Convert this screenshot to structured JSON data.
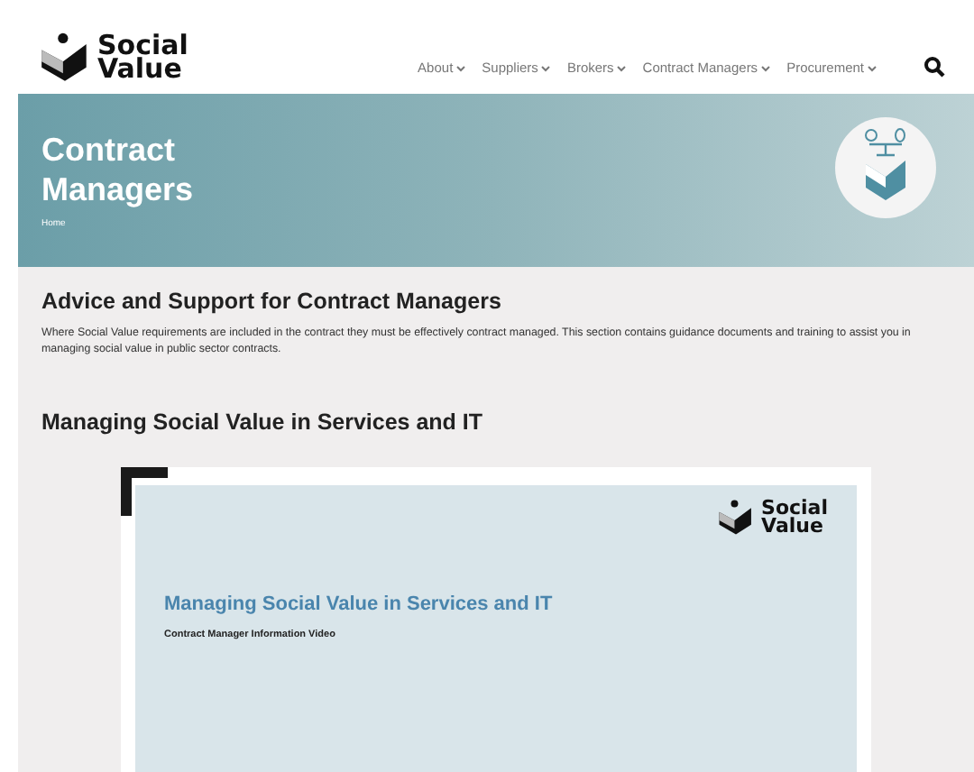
{
  "header": {
    "logo": {
      "line_1": "Social",
      "line_2": "Value"
    },
    "nav": [
      {
        "label": "About"
      },
      {
        "label": "Suppliers"
      },
      {
        "label": "Brokers"
      },
      {
        "label": "Contract Managers"
      },
      {
        "label": "Procurement"
      }
    ]
  },
  "banner": {
    "title_line_1": "Contract",
    "title_line_2": "Managers",
    "breadcrumb": "Home"
  },
  "intro": {
    "heading": "Advice and Support for Contract Managers",
    "text": "Where Social Value requirements are included in the contract they must be effectively contract managed. This section contains guidance documents and training to assist you in managing social value in public sector contracts."
  },
  "video_section": {
    "heading": "Managing Social Value in Services and IT",
    "slide": {
      "logo": {
        "line_1": "Social",
        "line_2": "Value"
      },
      "title": "Managing Social Value in Services and IT",
      "subtitle": "Contract Manager Information Video"
    }
  }
}
